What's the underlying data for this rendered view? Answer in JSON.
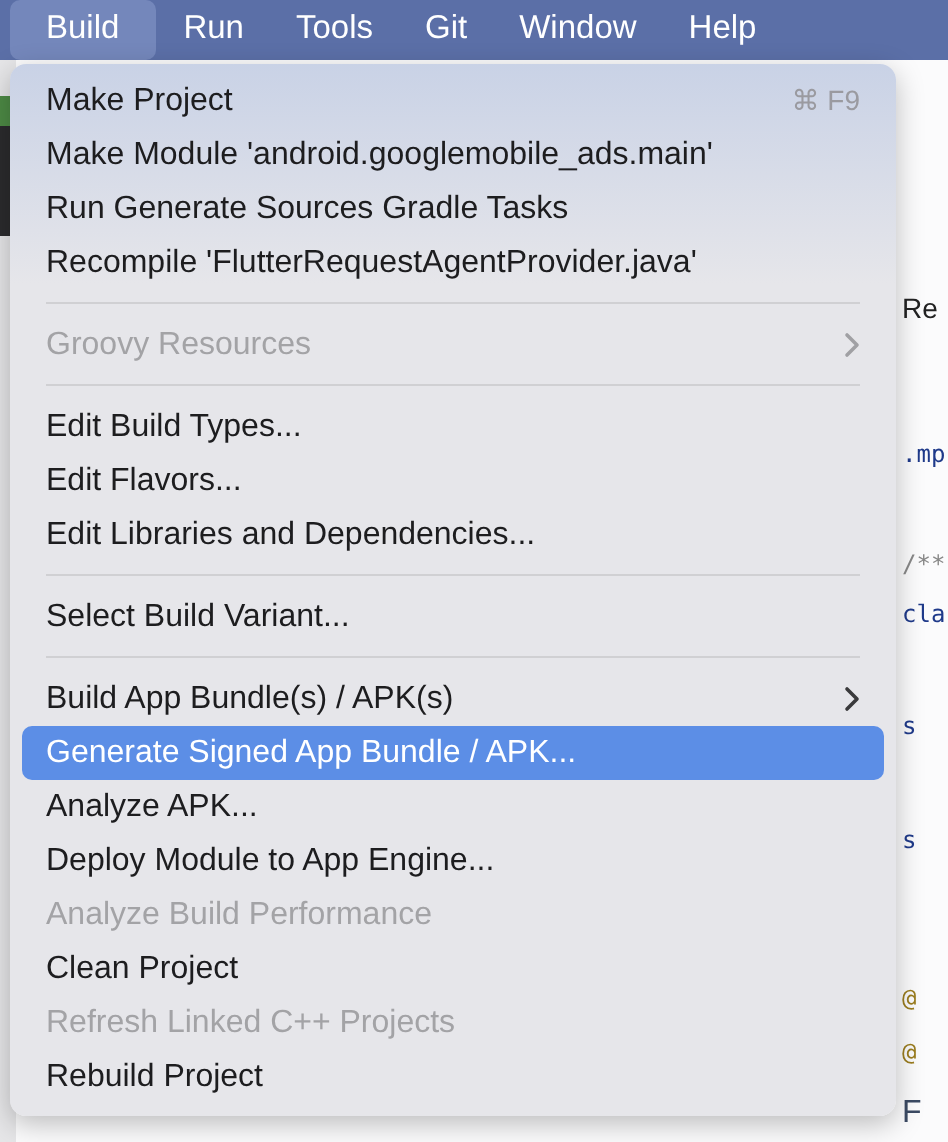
{
  "menu_bar": [
    {
      "label": "Build",
      "selected": true
    },
    {
      "label": "Run",
      "selected": false
    },
    {
      "label": "Tools",
      "selected": false
    },
    {
      "label": "Git",
      "selected": false
    },
    {
      "label": "Window",
      "selected": false
    },
    {
      "label": "Help",
      "selected": false
    }
  ],
  "menu": {
    "items": [
      {
        "kind": "item",
        "label": "Make Project",
        "shortcut": "⌘ F9",
        "disabled": false,
        "submenu": false,
        "selected": false
      },
      {
        "kind": "item",
        "label": "Make Module 'android.googlemobile_ads.main'",
        "disabled": false,
        "submenu": false,
        "selected": false
      },
      {
        "kind": "item",
        "label": "Run Generate Sources Gradle Tasks",
        "disabled": false,
        "submenu": false,
        "selected": false
      },
      {
        "kind": "item",
        "label": "Recompile 'FlutterRequestAgentProvider.java'",
        "disabled": false,
        "submenu": false,
        "selected": false
      },
      {
        "kind": "separator"
      },
      {
        "kind": "item",
        "label": "Groovy Resources",
        "disabled": true,
        "submenu": true,
        "selected": false
      },
      {
        "kind": "separator"
      },
      {
        "kind": "item",
        "label": "Edit Build Types...",
        "disabled": false,
        "submenu": false,
        "selected": false
      },
      {
        "kind": "item",
        "label": "Edit Flavors...",
        "disabled": false,
        "submenu": false,
        "selected": false
      },
      {
        "kind": "item",
        "label": "Edit Libraries and Dependencies...",
        "disabled": false,
        "submenu": false,
        "selected": false
      },
      {
        "kind": "separator"
      },
      {
        "kind": "item",
        "label": "Select Build Variant...",
        "disabled": false,
        "submenu": false,
        "selected": false
      },
      {
        "kind": "separator"
      },
      {
        "kind": "item",
        "label": "Build App Bundle(s) / APK(s)",
        "disabled": false,
        "submenu": true,
        "selected": false
      },
      {
        "kind": "item",
        "label": "Generate Signed App Bundle / APK...",
        "disabled": false,
        "submenu": false,
        "selected": true
      },
      {
        "kind": "item",
        "label": "Analyze APK...",
        "disabled": false,
        "submenu": false,
        "selected": false
      },
      {
        "kind": "item",
        "label": "Deploy Module to App Engine...",
        "disabled": false,
        "submenu": false,
        "selected": false
      },
      {
        "kind": "item",
        "label": "Analyze Build Performance",
        "disabled": true,
        "submenu": false,
        "selected": false
      },
      {
        "kind": "item",
        "label": "Clean Project",
        "disabled": false,
        "submenu": false,
        "selected": false
      },
      {
        "kind": "item",
        "label": "Refresh Linked C++ Projects",
        "disabled": true,
        "submenu": false,
        "selected": false
      },
      {
        "kind": "item",
        "label": "Rebuild Project",
        "disabled": false,
        "submenu": false,
        "selected": false
      }
    ]
  },
  "editor": {
    "fragments": [
      {
        "text": "Re",
        "kind": "tab"
      },
      {
        "text": ".mp",
        "kind": "code"
      },
      {
        "text": "/**",
        "kind": "comment"
      },
      {
        "text": "cla",
        "kind": "code"
      },
      {
        "text": "s",
        "kind": "code"
      },
      {
        "text": "s",
        "kind": "code"
      },
      {
        "text": "@",
        "kind": "annotation"
      },
      {
        "text": "@",
        "kind": "annotation"
      },
      {
        "text": "F",
        "kind": "plain"
      }
    ]
  }
}
